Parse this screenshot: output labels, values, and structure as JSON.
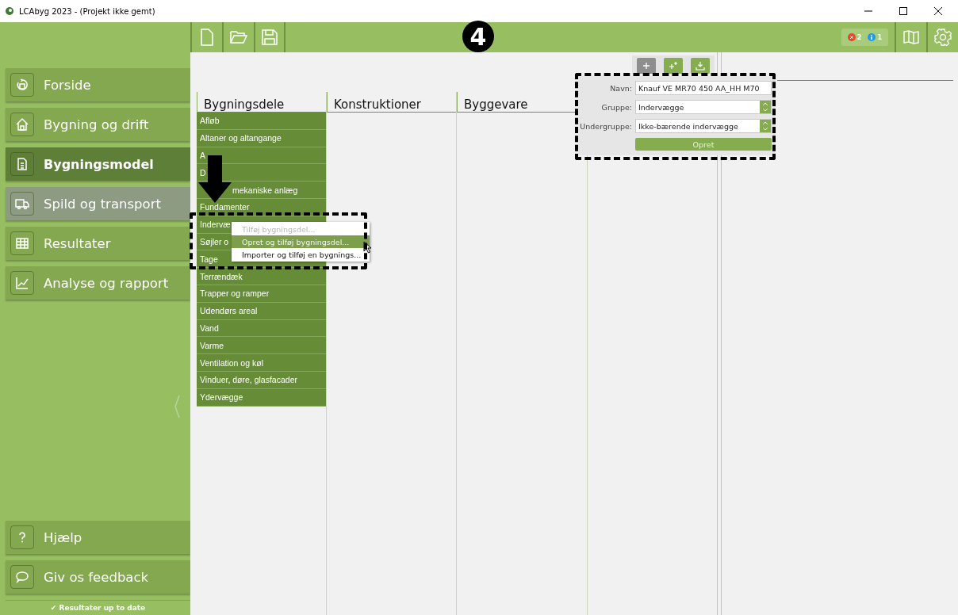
{
  "window": {
    "title": "LCAbyg 2023 - (Projekt ikke gemt)"
  },
  "toolbar": {
    "errors": "2",
    "infos": "1"
  },
  "step_badge": "4",
  "sidebar": {
    "items": [
      {
        "label": "Forside",
        "selected": false,
        "hovered": false
      },
      {
        "label": "Bygning og drift",
        "selected": false,
        "hovered": false
      },
      {
        "label": "Bygningsmodel",
        "selected": true,
        "hovered": false
      },
      {
        "label": "Spild og transport",
        "selected": false,
        "hovered": true
      },
      {
        "label": "Resultater",
        "selected": false,
        "hovered": false
      },
      {
        "label": "Analyse og rapport",
        "selected": false,
        "hovered": false
      }
    ],
    "bottom_items": [
      {
        "label": "Hjælp"
      },
      {
        "label": "Giv os feedback"
      }
    ],
    "status": "✔ Resultater up to date"
  },
  "columns": [
    {
      "title": "Bygningsdele"
    },
    {
      "title": "Konstruktioner"
    },
    {
      "title": "Byggevare"
    }
  ],
  "building_parts": [
    "Afløb",
    "Altaner og altangange",
    "A",
    "D",
    "mekaniske anlæg",
    "Fundamenter",
    "Indervæ",
    "Søjler o",
    "Tage",
    "Terrændæk",
    "Trapper og ramper",
    "Udendørs areal",
    "Vand",
    "Varme",
    "Ventilation og køl",
    "Vinduer, døre, glasfacader",
    "Ydervægge"
  ],
  "context_menu": [
    {
      "label": "Tilføj bygningsdel...",
      "disabled": true,
      "selected": false
    },
    {
      "label": "Opret og tilføj bygningsdel...",
      "disabled": false,
      "selected": true
    },
    {
      "label": "Importer og tilføj en bygnings...",
      "disabled": false,
      "selected": false
    }
  ],
  "panel_buttons": [
    {
      "selected": true
    },
    {
      "selected": false
    },
    {
      "selected": false
    }
  ],
  "create_panel": {
    "fields": [
      {
        "label": "Navn:",
        "value": "Knauf VE MR70 450 AA_HH M70",
        "kind": "text"
      },
      {
        "label": "Gruppe:",
        "value": "Indervægge",
        "kind": "select"
      },
      {
        "label": "Undergruppe:",
        "value": "Ikke-bærende indervægge",
        "kind": "select"
      }
    ],
    "button": "Opret"
  }
}
